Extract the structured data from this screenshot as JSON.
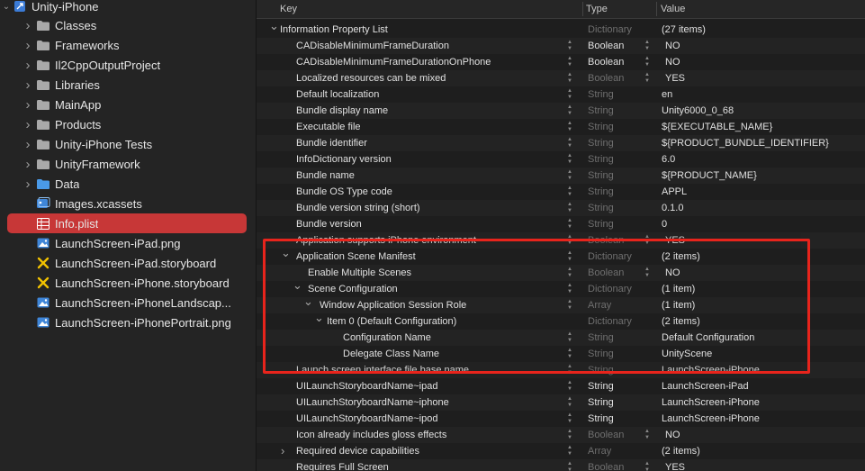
{
  "navigator": {
    "project": "Unity-iPhone",
    "items": [
      {
        "label": "Classes",
        "icon": "folder-icon",
        "expanded": false
      },
      {
        "label": "Frameworks",
        "icon": "folder-icon",
        "expanded": false
      },
      {
        "label": "Il2CppOutputProject",
        "icon": "folder-icon",
        "expanded": false
      },
      {
        "label": "Libraries",
        "icon": "folder-icon",
        "expanded": false
      },
      {
        "label": "MainApp",
        "icon": "folder-icon",
        "expanded": false
      },
      {
        "label": "Products",
        "icon": "folder-icon",
        "expanded": false
      },
      {
        "label": "Unity-iPhone Tests",
        "icon": "folder-icon",
        "expanded": false
      },
      {
        "label": "UnityFramework",
        "icon": "folder-icon",
        "expanded": false
      },
      {
        "label": "Data",
        "icon": "blue-folder-icon",
        "expanded": false
      },
      {
        "label": "Images.xcassets",
        "icon": "asset-catalog-icon"
      },
      {
        "label": "Info.plist",
        "icon": "plist-icon",
        "selected": true
      },
      {
        "label": "LaunchScreen-iPad.png",
        "icon": "image-icon"
      },
      {
        "label": "LaunchScreen-iPad.storyboard",
        "icon": "storyboard-icon"
      },
      {
        "label": "LaunchScreen-iPhone.storyboard",
        "icon": "storyboard-icon"
      },
      {
        "label": "LaunchScreen-iPhoneLandscap...",
        "icon": "image-icon"
      },
      {
        "label": "LaunchScreen-iPhonePortrait.png",
        "icon": "image-icon"
      }
    ]
  },
  "plist": {
    "headers": {
      "key": "Key",
      "type": "Type",
      "value": "Value"
    },
    "rows": [
      {
        "indent": 0,
        "toggle": "open",
        "key": "Information Property List",
        "type": "Dictionary",
        "value": "(27 items)",
        "typeDim": true,
        "valueDim": true,
        "stepKey": false,
        "stepType": false
      },
      {
        "indent": 1,
        "key": "CADisableMinimumFrameDuration",
        "type": "Boolean",
        "value": "NO",
        "typeDim": false,
        "stepKey": true,
        "stepType": true
      },
      {
        "indent": 1,
        "key": "CADisableMinimumFrameDurationOnPhone",
        "type": "Boolean",
        "value": "NO",
        "typeDim": false,
        "stepKey": true,
        "stepType": true
      },
      {
        "indent": 1,
        "key": "Localized resources can be mixed",
        "type": "Boolean",
        "value": "YES",
        "typeDim": true,
        "stepKey": true,
        "stepType": true
      },
      {
        "indent": 1,
        "key": "Default localization",
        "type": "String",
        "value": "en",
        "typeDim": true,
        "stepKey": true,
        "stepType": false
      },
      {
        "indent": 1,
        "key": "Bundle display name",
        "type": "String",
        "value": "Unity6000_0_68",
        "typeDim": true,
        "stepKey": true,
        "stepType": false
      },
      {
        "indent": 1,
        "key": "Executable file",
        "type": "String",
        "value": "${EXECUTABLE_NAME}",
        "typeDim": true,
        "stepKey": true,
        "stepType": false
      },
      {
        "indent": 1,
        "key": "Bundle identifier",
        "type": "String",
        "value": "${PRODUCT_BUNDLE_IDENTIFIER}",
        "typeDim": true,
        "stepKey": true,
        "stepType": false
      },
      {
        "indent": 1,
        "key": "InfoDictionary version",
        "type": "String",
        "value": "6.0",
        "typeDim": true,
        "stepKey": true,
        "stepType": false
      },
      {
        "indent": 1,
        "key": "Bundle name",
        "type": "String",
        "value": "${PRODUCT_NAME}",
        "typeDim": true,
        "stepKey": true,
        "stepType": false
      },
      {
        "indent": 1,
        "key": "Bundle OS Type code",
        "type": "String",
        "value": "APPL",
        "typeDim": true,
        "stepKey": true,
        "stepType": false
      },
      {
        "indent": 1,
        "key": "Bundle version string (short)",
        "type": "String",
        "value": "0.1.0",
        "typeDim": true,
        "stepKey": true,
        "stepType": false
      },
      {
        "indent": 1,
        "key": "Bundle version",
        "type": "String",
        "value": "0",
        "typeDim": true,
        "stepKey": true,
        "stepType": false
      },
      {
        "indent": 1,
        "key": "Application supports iPhone environment",
        "type": "Boolean",
        "value": "YES",
        "typeDim": true,
        "stepKey": true,
        "stepType": true,
        "obscured": true
      },
      {
        "indent": 1,
        "toggle": "open",
        "key": "Application Scene Manifest",
        "type": "Dictionary",
        "value": "(2 items)",
        "typeDim": true,
        "valueDim": false,
        "stepKey": true,
        "stepType": false
      },
      {
        "indent": 2,
        "key": "Enable Multiple Scenes",
        "type": "Boolean",
        "value": "NO",
        "typeDim": true,
        "stepKey": true,
        "stepType": true
      },
      {
        "indent": 2,
        "toggle": "open",
        "key": "Scene Configuration",
        "type": "Dictionary",
        "value": "(1 item)",
        "typeDim": true,
        "stepKey": true,
        "stepType": false
      },
      {
        "indent": 3,
        "toggle": "open",
        "key": "Window Application Session Role",
        "type": "Array",
        "value": "(1 item)",
        "typeDim": true,
        "stepKey": true,
        "stepType": false
      },
      {
        "indent": 4,
        "toggle": "open",
        "key": "Item 0 (Default Configuration)",
        "type": "Dictionary",
        "value": "(2 items)",
        "typeDim": true,
        "stepKey": false,
        "stepType": false
      },
      {
        "indent": 5,
        "key": "Configuration Name",
        "type": "String",
        "value": "Default Configuration",
        "typeDim": true,
        "stepKey": true,
        "stepType": false
      },
      {
        "indent": 5,
        "key": "Delegate Class Name",
        "type": "String",
        "value": "UnityScene",
        "typeDim": true,
        "stepKey": true,
        "stepType": false
      },
      {
        "indent": 1,
        "key": "Launch screen interface file base name",
        "type": "String",
        "value": "LaunchScreen-iPhone",
        "typeDim": true,
        "stepKey": true,
        "stepType": false,
        "obscured": true
      },
      {
        "indent": 1,
        "key": "UILaunchStoryboardName~ipad",
        "type": "String",
        "value": "LaunchScreen-iPad",
        "typeDim": false,
        "stepKey": true,
        "stepType": false
      },
      {
        "indent": 1,
        "key": "UILaunchStoryboardName~iphone",
        "type": "String",
        "value": "LaunchScreen-iPhone",
        "typeDim": false,
        "stepKey": true,
        "stepType": false
      },
      {
        "indent": 1,
        "key": "UILaunchStoryboardName~ipod",
        "type": "String",
        "value": "LaunchScreen-iPhone",
        "typeDim": false,
        "stepKey": true,
        "stepType": false
      },
      {
        "indent": 1,
        "key": "Icon already includes gloss effects",
        "type": "Boolean",
        "value": "NO",
        "typeDim": true,
        "stepKey": true,
        "stepType": true
      },
      {
        "indent": 1,
        "toggle": "closed",
        "key": "Required device capabilities",
        "type": "Array",
        "value": "(2 items)",
        "typeDim": true,
        "valueDim": true,
        "stepKey": true,
        "stepType": false
      },
      {
        "indent": 1,
        "key": "Requires Full Screen",
        "type": "Boolean",
        "value": "YES",
        "typeDim": true,
        "stepKey": true,
        "stepType": true
      }
    ]
  },
  "colors": {
    "selection": "#d63a3a",
    "highlight": "#e8241c",
    "folder": "#7fb3e8"
  }
}
